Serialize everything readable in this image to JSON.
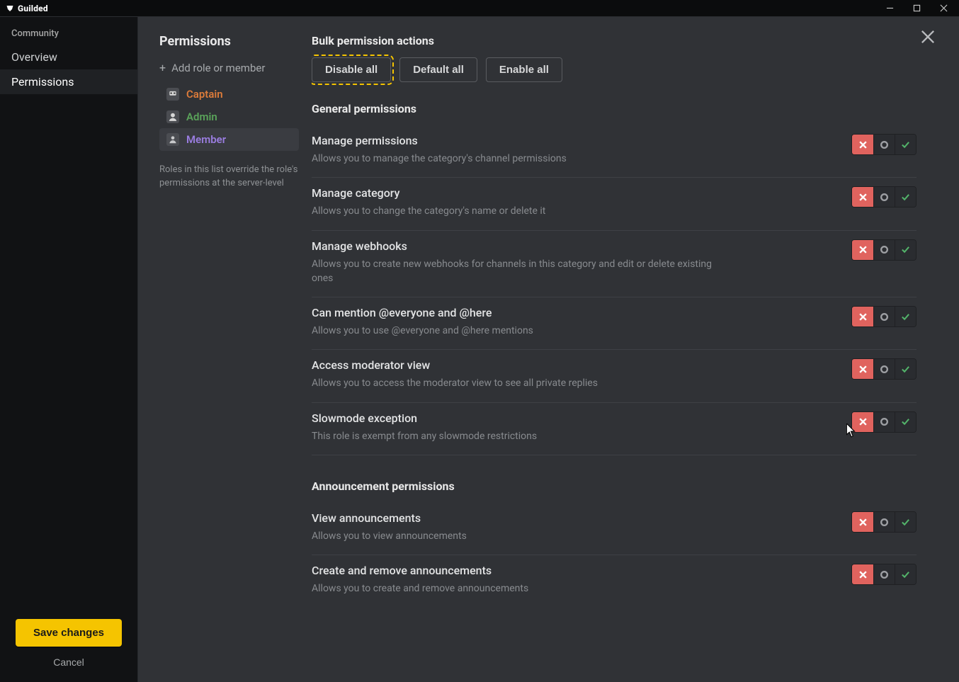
{
  "titlebar": {
    "app_name": "Guilded"
  },
  "sidebar": {
    "section": "Community",
    "items": [
      {
        "label": "Overview",
        "active": false
      },
      {
        "label": "Permissions",
        "active": true
      }
    ],
    "save_label": "Save changes",
    "cancel_label": "Cancel"
  },
  "detail": {
    "title": "Permissions",
    "add_role_label": "Add role or member",
    "roles": [
      {
        "name": "Captain",
        "css": "role-captain",
        "selected": false
      },
      {
        "name": "Admin",
        "css": "role-admin",
        "selected": false
      },
      {
        "name": "Member",
        "css": "role-member",
        "selected": true
      }
    ],
    "roles_note": "Roles in this list override the role's permissions at the server-level",
    "bulk_heading": "Bulk permission actions",
    "bulk": {
      "disable": "Disable all",
      "default": "Default all",
      "enable": "Enable all"
    },
    "groups": [
      {
        "heading": "General permissions",
        "perms": [
          {
            "title": "Manage permissions",
            "desc": "Allows you to manage the category's channel permissions",
            "state": "deny"
          },
          {
            "title": "Manage category",
            "desc": "Allows you to change the category's name or delete it",
            "state": "deny"
          },
          {
            "title": "Manage webhooks",
            "desc": "Allows you to create new webhooks for channels in this category and edit or delete existing ones",
            "state": "deny"
          },
          {
            "title": "Can mention @everyone and @here",
            "desc": "Allows you to use @everyone and @here mentions",
            "state": "deny"
          },
          {
            "title": "Access moderator view",
            "desc": "Allows you to access the moderator view to see all private replies",
            "state": "deny"
          },
          {
            "title": "Slowmode exception",
            "desc": "This role is exempt from any slowmode restrictions",
            "state": "deny"
          }
        ]
      },
      {
        "heading": "Announcement permissions",
        "perms": [
          {
            "title": "View announcements",
            "desc": "Allows you to view announcements",
            "state": "deny"
          },
          {
            "title": "Create and remove announcements",
            "desc": "Allows you to create and remove announcements",
            "state": "deny"
          }
        ]
      }
    ]
  }
}
